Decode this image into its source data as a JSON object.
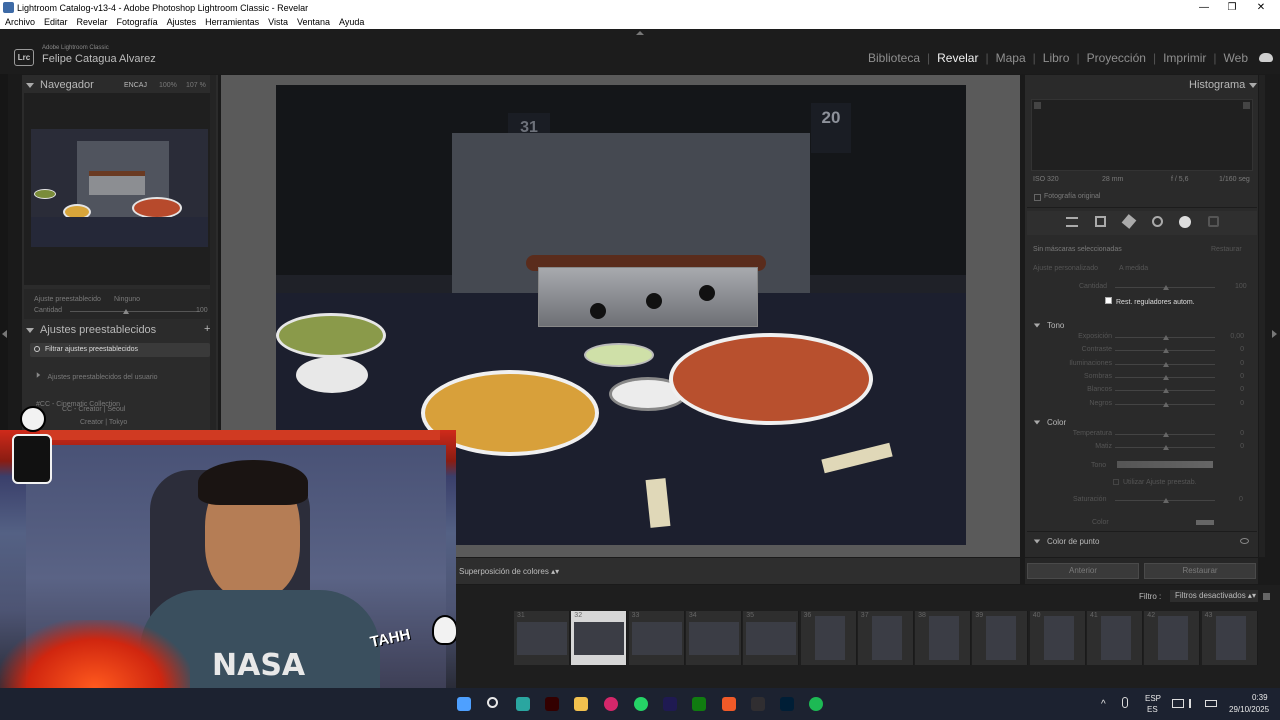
{
  "window": {
    "title": "Lightroom Catalog-v13-4 - Adobe Photoshop Lightroom Classic - Revelar",
    "menu": [
      "Archivo",
      "Editar",
      "Revelar",
      "Fotografía",
      "Ajustes",
      "Herramientas",
      "Vista",
      "Ventana",
      "Ayuda"
    ]
  },
  "header": {
    "logo": "Lrc",
    "brand": "Adobe Lightroom Classic",
    "user": "Felipe Catagua Alvarez",
    "modules": [
      "Biblioteca",
      "Revelar",
      "Mapa",
      "Libro",
      "Proyección",
      "Imprimir",
      "Web"
    ],
    "active_module": "Revelar"
  },
  "left": {
    "navigator_title": "Navegador",
    "fit": "ENCAJ",
    "zoom1": "100%",
    "zoom2": "107 %",
    "preset_label": "Ajuste preestablecido",
    "preset_value": "Ninguno",
    "amount_label": "Cantidad",
    "amount_value": "100",
    "presets_title": "Ajustes preestablecidos",
    "filter_presets": "Filtrar ajustes preestablecidos",
    "user_presets": "Ajustes preestablecidos del usuario",
    "collection": "#CC - Cinematic Collection",
    "item1": "CC - Creator | Seoul",
    "item2": "Creator | Tokyo"
  },
  "right": {
    "histogram_title": "Histograma",
    "iso": "ISO 320",
    "focal": "28 mm",
    "aperture": "f / 5,6",
    "shutter": "1/160 seg",
    "original_photo": "Fotografía original",
    "no_masks": "Sin máscaras seleccionadas",
    "restore": "Restaurar",
    "custom_adjust": "Ajuste personalizado",
    "measure": "A medida",
    "amount": "Cantidad",
    "amount_value": "100",
    "auto_reset": "Rest. reguladores autom.",
    "tone_title": "Tono",
    "tone_rows": [
      {
        "label": "Exposición",
        "value": "0,00"
      },
      {
        "label": "Contraste",
        "value": "0"
      },
      {
        "label": "Iluminaciones",
        "value": "0"
      },
      {
        "label": "Sombras",
        "value": "0"
      },
      {
        "label": "Blancos",
        "value": "0"
      },
      {
        "label": "Negros",
        "value": "0"
      }
    ],
    "color_title": "Color",
    "color_rows": [
      {
        "label": "Temperatura",
        "value": "0"
      },
      {
        "label": "Matiz",
        "value": "0"
      }
    ],
    "tint_label": "Tono",
    "use_preset": "Utilizar Ajuste preestab.",
    "saturation": "Saturación",
    "saturation_value": "0",
    "color_label": "Color",
    "point_color_title": "Color de punto",
    "previous": "Anterior",
    "reset": "Restaurar"
  },
  "toolbar": {
    "overlay": "Superposición de colores"
  },
  "filmstrip": {
    "filter_label": "Filtro :",
    "filter_value": "Filtros desactivados",
    "numbers": [
      "31",
      "32",
      "33",
      "34",
      "35",
      "36",
      "37",
      "38",
      "39",
      "40",
      "41",
      "42",
      "43"
    ]
  },
  "photo": {
    "jersey1": "31",
    "jersey2": "20"
  },
  "webcam": {
    "shirt": "NASA",
    "sticker": "TAHH"
  },
  "taskbar": {
    "lang1": "ESP",
    "lang2": "ES",
    "time": "0:39",
    "date": "29/10/2025"
  },
  "colors": {
    "accent_lr": "#3d6aa6",
    "panel_bg": "#2b2b2b",
    "active_text": "#f0f0f0"
  }
}
